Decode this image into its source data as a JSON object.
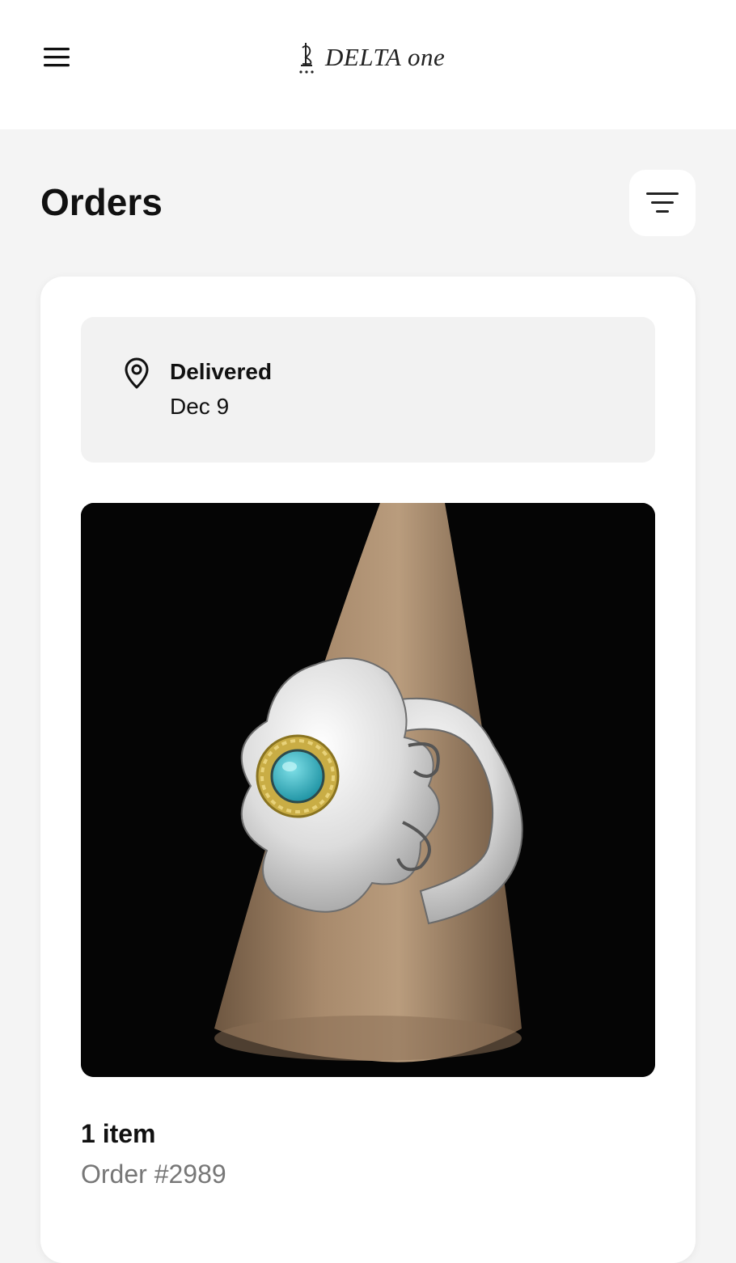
{
  "header": {
    "menu_icon": "hamburger-menu-icon",
    "brand": "DELTA one"
  },
  "page": {
    "title": "Orders",
    "filter_icon": "filter-icon"
  },
  "order": {
    "status_icon": "location-pin-icon",
    "status": "Delivered",
    "date": "Dec 9",
    "item_count": "1 item",
    "order_number": "Order #2989",
    "image_description": "silver ring with turquoise stone"
  },
  "colors": {
    "background": "#f4f4f4",
    "card": "#ffffff",
    "status_box": "#f2f2f2",
    "muted_text": "#777777"
  }
}
